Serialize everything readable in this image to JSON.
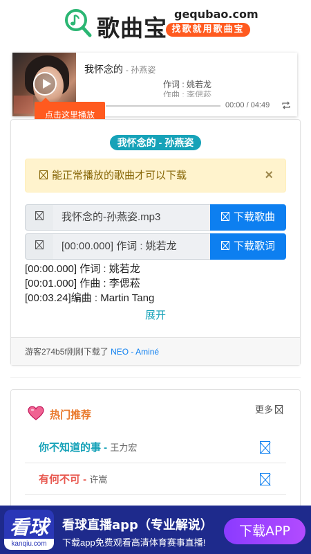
{
  "header": {
    "title": "歌曲宝",
    "domain": "gequbao.com",
    "slogan": "找歌就用歌曲宝"
  },
  "player": {
    "title": "我怀念的",
    "artist": "- 孙燕姿",
    "lyric_line1": "作词 : 姚若龙",
    "lyric_line2": "作曲 : 李偲菘",
    "time": "00:00 / 04:49",
    "tooltip": "点击这里播放"
  },
  "song": {
    "badge": "我怀念的 - 孙燕姿",
    "alert_text": "能正常播放的歌曲才可以下载",
    "alert_close": "×",
    "download_song": {
      "value": "我怀念的-孙燕姿.mp3",
      "button": "下载歌曲"
    },
    "download_lyrics": {
      "value": "[00:00.000] 作词 : 姚若龙",
      "button": "下载歌词"
    },
    "lyrics": [
      "[00:00.000] 作词 : 姚若龙",
      "[00:01.000] 作曲 : 李偲菘",
      "[00:03.24]编曲 : Martin Tang"
    ],
    "expand": "展开",
    "footer_prefix": "游客274b5f刚刚下载了",
    "footer_link": "NEO - Aminé"
  },
  "hot": {
    "title": "热门推荐",
    "more": "更多",
    "items": [
      {
        "name": "你不知道的事",
        "sep": " - ",
        "artist": "王力宏",
        "color": "#16a2b8"
      },
      {
        "name": "有何不可",
        "sep": " - ",
        "artist": "许嵩",
        "color": "#e8584f"
      },
      {
        "name": "",
        "sep": "",
        "artist": "",
        "color": "#16a2b8"
      }
    ]
  },
  "ad": {
    "logo": "看球",
    "logo_sub": "kanqiu.com",
    "title": "看球直播app（专业解说）",
    "subtitle": "下载app免费观看高清体育赛事直播!",
    "button": "下载APP"
  },
  "colors": {
    "accent_orange": "#ff5a1f",
    "teal": "#16a2b8",
    "blue": "#0d7ff0",
    "ad_bg": "#1e2a8c"
  }
}
